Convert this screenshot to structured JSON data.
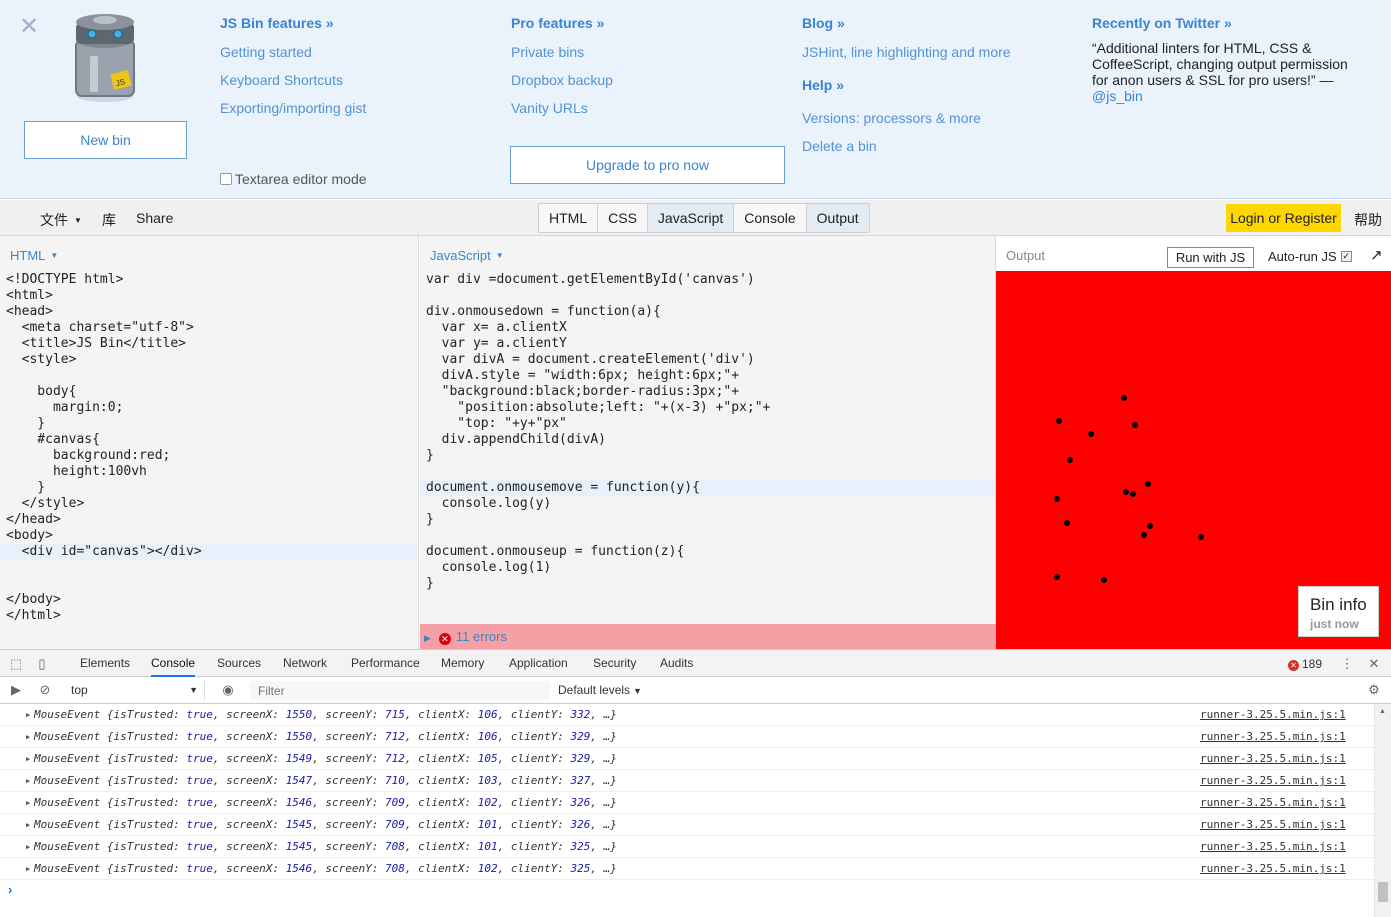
{
  "info": {
    "close_icon": "close-icon",
    "new_bin": "New bin",
    "col1": {
      "heading": "JS Bin features »",
      "links": [
        "Getting started",
        "Keyboard Shortcuts",
        "Exporting/importing gist"
      ]
    },
    "col2": {
      "heading": "Pro features »",
      "links": [
        "Private bins",
        "Dropbox backup",
        "Vanity URLs"
      ]
    },
    "col3": {
      "heading": "Blog »",
      "links": [
        "JSHint, line highlighting and more"
      ],
      "heading2": "Help »",
      "links2": [
        "Versions: processors & more",
        "Delete a bin"
      ]
    },
    "col4": {
      "heading": "Recently on Twitter »",
      "tweet": "“Additional linters for HTML, CSS & CoffeeScript, changing output permission for anon users & SSL for pro users!” —",
      "handle": "@js_bin"
    },
    "textarea_mode": "Textarea editor mode",
    "upgrade": "Upgrade to pro now"
  },
  "toolbar": {
    "file": "文件",
    "library": "库",
    "share": "Share",
    "tabs": [
      "HTML",
      "CSS",
      "JavaScript",
      "Console",
      "Output"
    ],
    "login": "Login or Register",
    "help": "帮助"
  },
  "html_pane": {
    "label": "HTML",
    "lines": [
      "<!DOCTYPE html>",
      "<html>",
      "<head>",
      "  <meta charset=\"utf-8\">",
      "  <title>JS Bin</title>",
      "  <style>",
      "",
      "    body{",
      "      margin:0;",
      "    }",
      "    #canvas{",
      "      background:red;",
      "      height:100vh",
      "    }",
      "  </style>",
      "</head>",
      "<body>",
      "  <div id=\"canvas\"></div>",
      "",
      "",
      "</body>",
      "</html>"
    ]
  },
  "js_pane": {
    "label": "JavaScript",
    "lines": [
      "var div =document.getElementById('canvas')",
      "",
      "div.onmousedown = function(a){",
      "  var x= a.clientX",
      "  var y= a.clientY",
      "  var divA = document.createElement('div')",
      "  divA.style = \"width:6px; height:6px;\"+",
      "  \"background:black;border-radius:3px;\"+",
      "    \"position:absolute;left: \"+(x-3) +\"px;\"+",
      "    \"top: \"+y+\"px\"",
      "  div.appendChild(divA)",
      "}",
      "",
      "document.onmousemove = function(y){",
      "  console.log(y)",
      "}",
      "",
      "document.onmouseup = function(z){",
      "  console.log(1)",
      "}"
    ],
    "errors": "11 errors"
  },
  "output": {
    "label": "Output",
    "run": "Run with JS",
    "autorun": "Auto-run JS",
    "popout_icon": "popout-arrow-icon",
    "canvas_color": "#ff0000",
    "bin_info_title": "Bin info",
    "bin_info_sub": "just now"
  },
  "devtools": {
    "tabs": [
      "Elements",
      "Console",
      "Sources",
      "Network",
      "Performance",
      "Memory",
      "Application",
      "Security",
      "Audits"
    ],
    "error_count": "189",
    "context": "top",
    "filter_placeholder": "Filter",
    "levels": "Default levels",
    "logs": [
      {
        "screenX": "1550",
        "screenY": "715",
        "clientX": "106",
        "clientY": "332"
      },
      {
        "screenX": "1550",
        "screenY": "712",
        "clientX": "106",
        "clientY": "329"
      },
      {
        "screenX": "1549",
        "screenY": "712",
        "clientX": "105",
        "clientY": "329"
      },
      {
        "screenX": "1547",
        "screenY": "710",
        "clientX": "103",
        "clientY": "327"
      },
      {
        "screenX": "1546",
        "screenY": "709",
        "clientX": "102",
        "clientY": "326"
      },
      {
        "screenX": "1545",
        "screenY": "709",
        "clientX": "101",
        "clientY": "326"
      },
      {
        "screenX": "1545",
        "screenY": "708",
        "clientX": "101",
        "clientY": "325"
      },
      {
        "screenX": "1546",
        "screenY": "708",
        "clientX": "102",
        "clientY": "325"
      }
    ],
    "log_source": "runner-3.25.5.min.js:1"
  }
}
